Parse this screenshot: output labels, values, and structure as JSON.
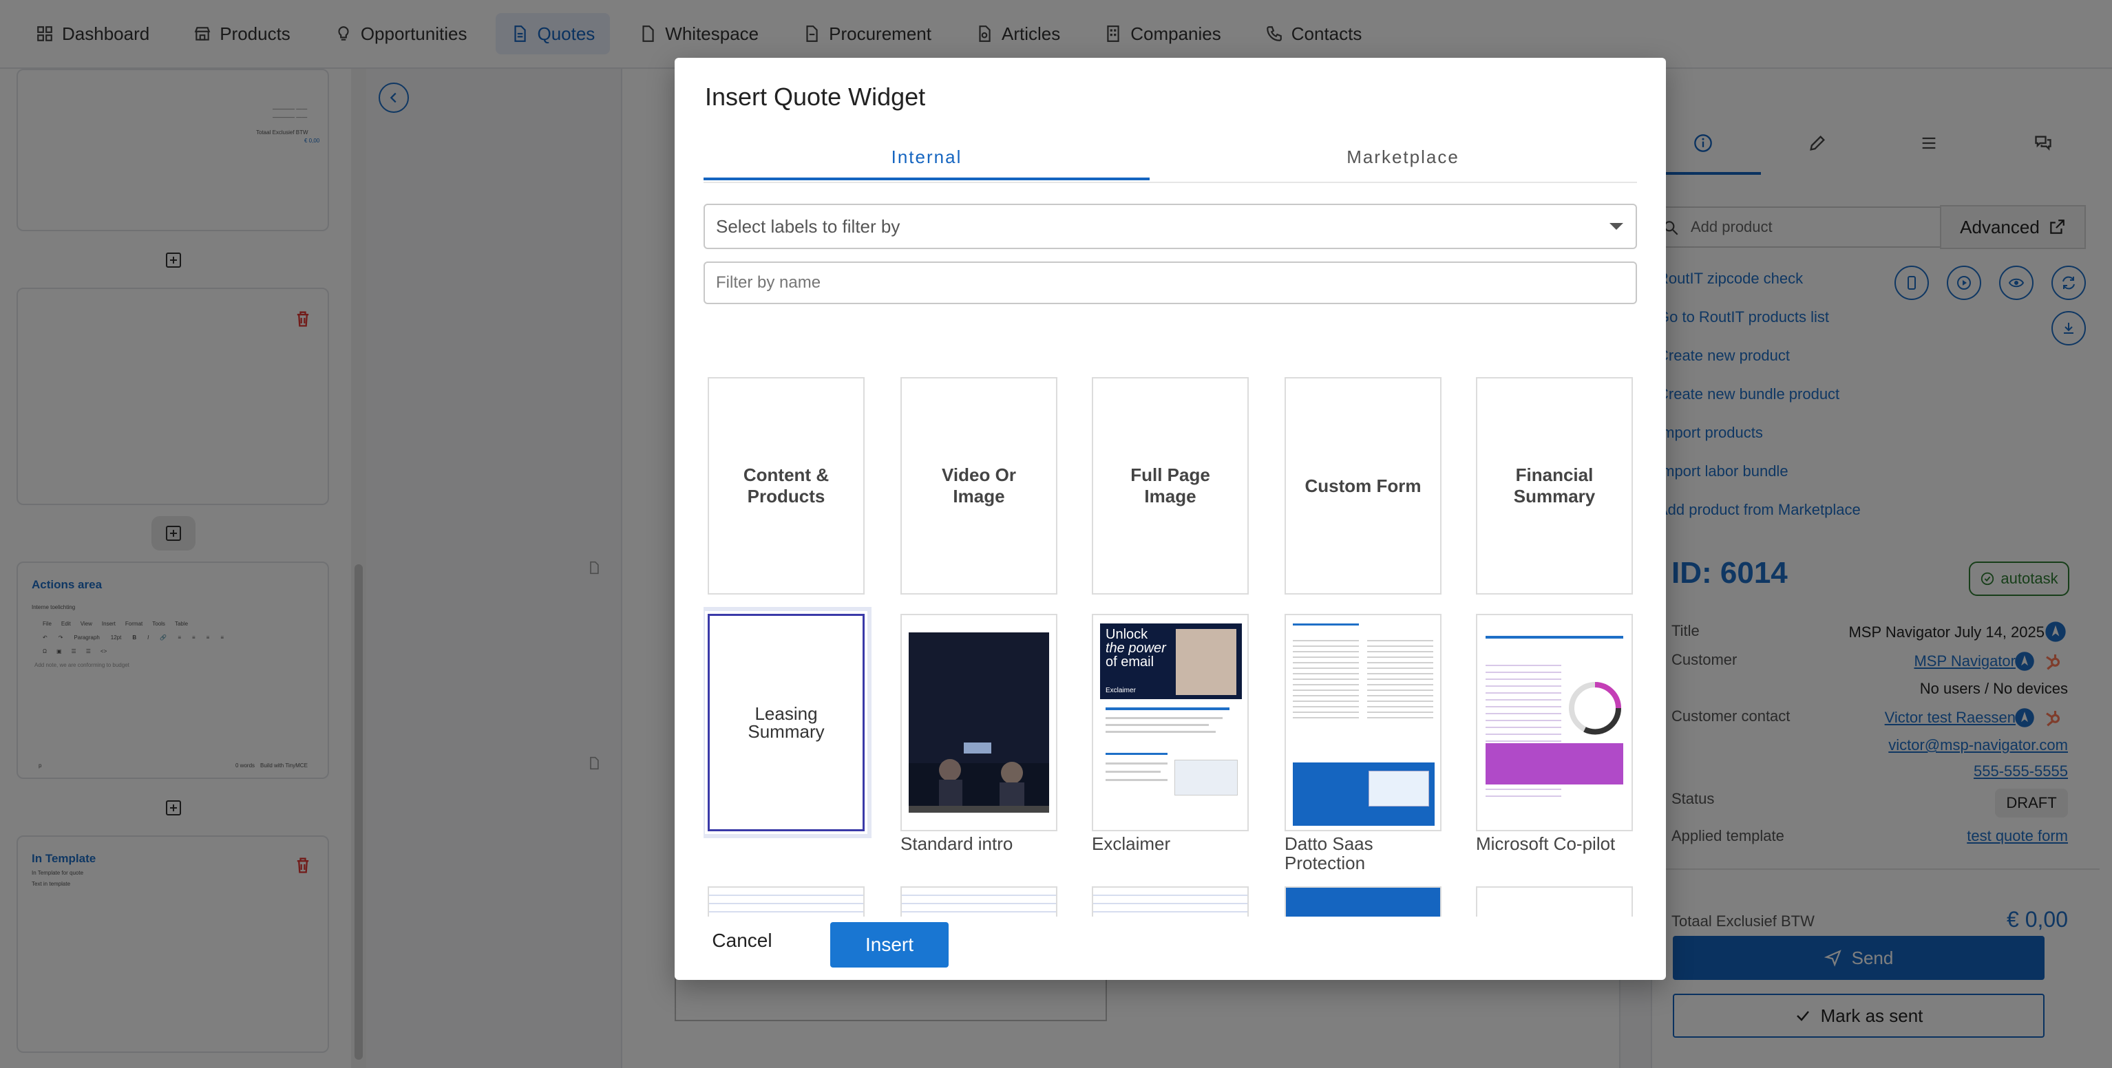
{
  "nav": {
    "items": [
      {
        "label": "Dashboard",
        "icon": "grid-icon"
      },
      {
        "label": "Products",
        "icon": "store-icon"
      },
      {
        "label": "Opportunities",
        "icon": "lightbulb-icon"
      },
      {
        "label": "Quotes",
        "icon": "document-icon"
      },
      {
        "label": "Whitespace",
        "icon": "document-icon"
      },
      {
        "label": "Procurement",
        "icon": "document-icon"
      },
      {
        "label": "Articles",
        "icon": "document-search-icon"
      },
      {
        "label": "Companies",
        "icon": "building-icon"
      },
      {
        "label": "Contacts",
        "icon": "phone-icon"
      }
    ],
    "active": "Quotes"
  },
  "left_panel": {
    "totals_label": "Totaal Exclusief BTW",
    "totals_value_1": "€ 0,00",
    "totals_value_2": "€ 0,00",
    "actions_area": {
      "title": "Actions area",
      "editor_label": "Interne toelichting",
      "menu": [
        "File",
        "Edit",
        "View",
        "Insert",
        "Format",
        "Tools",
        "Table"
      ],
      "format": "Paragraph",
      "font_size": "12pt",
      "placeholder": "Add note, we are conforming to budget",
      "wordcount": "0 words",
      "brand": "Build with TinyMCE"
    },
    "in_template": {
      "title": "In Template",
      "line1": "In Template for quote",
      "line2": "Text in template"
    }
  },
  "modal": {
    "title": "Insert Quote Widget",
    "tabs": [
      "Internal",
      "Marketplace"
    ],
    "active_tab": "Internal",
    "label_filter_placeholder": "Select labels to filter by",
    "name_filter_placeholder": "Filter by name",
    "widgets": [
      {
        "tile_text": "Content & Products",
        "caption": ""
      },
      {
        "tile_text": "Video Or Image",
        "caption": ""
      },
      {
        "tile_text": "Full Page Image",
        "caption": ""
      },
      {
        "tile_text": "Custom Form",
        "caption": ""
      },
      {
        "tile_text": "Financial Summary",
        "caption": ""
      },
      {
        "tile_text": "Leasing Summary",
        "caption": "",
        "selected": true
      },
      {
        "tile_text": "",
        "caption": "Standard intro"
      },
      {
        "tile_text": "",
        "caption": "Exclaimer"
      },
      {
        "tile_text": "",
        "caption": "Datto Saas Protection"
      },
      {
        "tile_text": "",
        "caption": "Microsoft Co-pilot"
      }
    ],
    "exclaimer_preview": {
      "headline_1": "Unlock",
      "headline_2": "the power",
      "headline_3": "of email",
      "brand": "Exclaimer"
    },
    "cancel_label": "Cancel",
    "insert_label": "Insert"
  },
  "right_panel": {
    "search_placeholder": "Add product",
    "advanced_label": "Advanced",
    "links": [
      "RoutIT zipcode check",
      "Go to RoutIT products list",
      "Create new product",
      "Create new bundle product",
      "Import products",
      "Import labor bundle",
      "Add product from Marketplace"
    ],
    "id": "ID: 6014",
    "autotask": "autotask",
    "fields": {
      "title_label": "Title",
      "title_value": "MSP Navigator July 14, 2025",
      "customer_label": "Customer",
      "customer_value": "MSP Navigator",
      "customer_sub": "No users / No devices",
      "contact_label": "Customer contact",
      "contact_name": "Victor test Raessen",
      "contact_email": "victor@msp-navigator.com",
      "contact_phone": "555-555-5555",
      "status_label": "Status",
      "status_value": "DRAFT",
      "template_label": "Applied template",
      "template_value": "test quote form"
    },
    "total_label": "Totaal Exclusief BTW",
    "total_value": "€ 0,00",
    "send_label": "Send",
    "mark_sent_label": "Mark as sent"
  },
  "colors": {
    "primary": "#1565c0",
    "link": "#1e6fc7",
    "success": "#2e7d32",
    "danger": "#e53935",
    "hubspot": "#ff7a59"
  }
}
